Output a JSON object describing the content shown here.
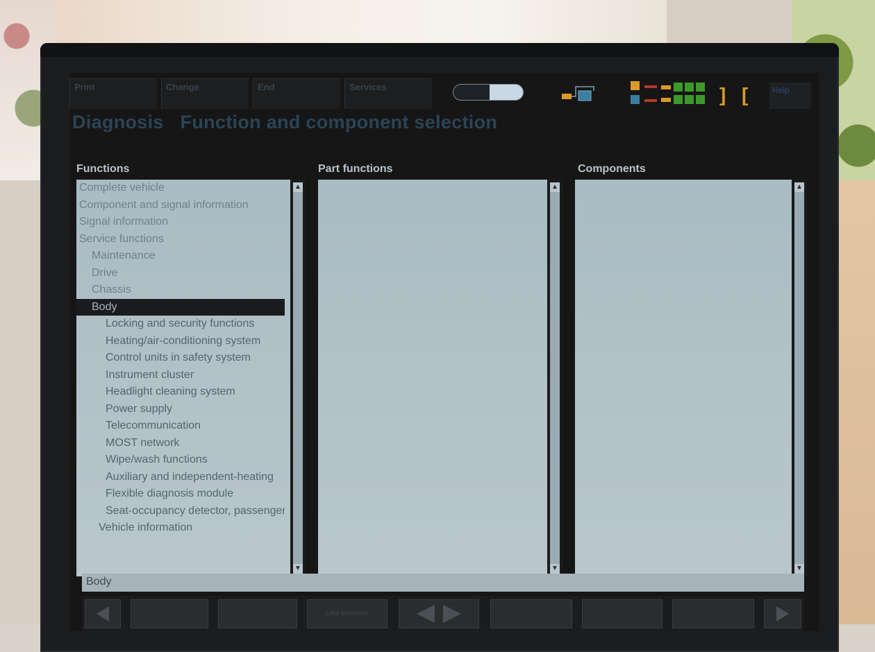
{
  "menu": {
    "items": [
      "Print",
      "Change",
      "End",
      "Services"
    ],
    "help": "Help"
  },
  "title": {
    "section": "Diagnosis",
    "heading": "Function and component selection"
  },
  "columns": {
    "functions": "Functions",
    "part_functions": "Part functions",
    "components": "Components"
  },
  "functions": [
    {
      "label": "Complete vehicle",
      "level": 0
    },
    {
      "label": "Component and signal information",
      "level": 0
    },
    {
      "label": "Signal information",
      "level": 0
    },
    {
      "label": "Service functions",
      "level": 0
    },
    {
      "label": "Maintenance",
      "level": 1
    },
    {
      "label": "Drive",
      "level": 1
    },
    {
      "label": "Chassis",
      "level": 1
    },
    {
      "label": "Body",
      "level": 1,
      "selected": true
    },
    {
      "label": "Locking and security functions",
      "level": 2
    },
    {
      "label": "Heating/air-conditioning system",
      "level": 2
    },
    {
      "label": "Control units in safety system",
      "level": 2
    },
    {
      "label": "Instrument cluster",
      "level": 2
    },
    {
      "label": "Headlight cleaning system",
      "level": 2
    },
    {
      "label": "Power supply",
      "level": 2
    },
    {
      "label": "Telecommunication",
      "level": 2
    },
    {
      "label": "MOST network",
      "level": 2
    },
    {
      "label": "Wipe/wash functions",
      "level": 2
    },
    {
      "label": "Auxiliary and independent-heating",
      "level": 2
    },
    {
      "label": "Flexible diagnosis module",
      "level": 2
    },
    {
      "label": "Seat-occupancy detector, passenger",
      "level": 2
    },
    {
      "label": "Vehicle information",
      "level": 3
    }
  ],
  "status": "Body",
  "bottom_buttons": [
    "",
    "",
    "Last selection",
    "",
    "",
    "",
    "",
    "",
    ""
  ],
  "colors": {
    "screen_bg": "#161616",
    "panel": "#b2c2c8",
    "title": "#2b4456",
    "led_green": "#3d9a2a",
    "led_orange": "#d99a2a",
    "led_red": "#b23a2a"
  }
}
